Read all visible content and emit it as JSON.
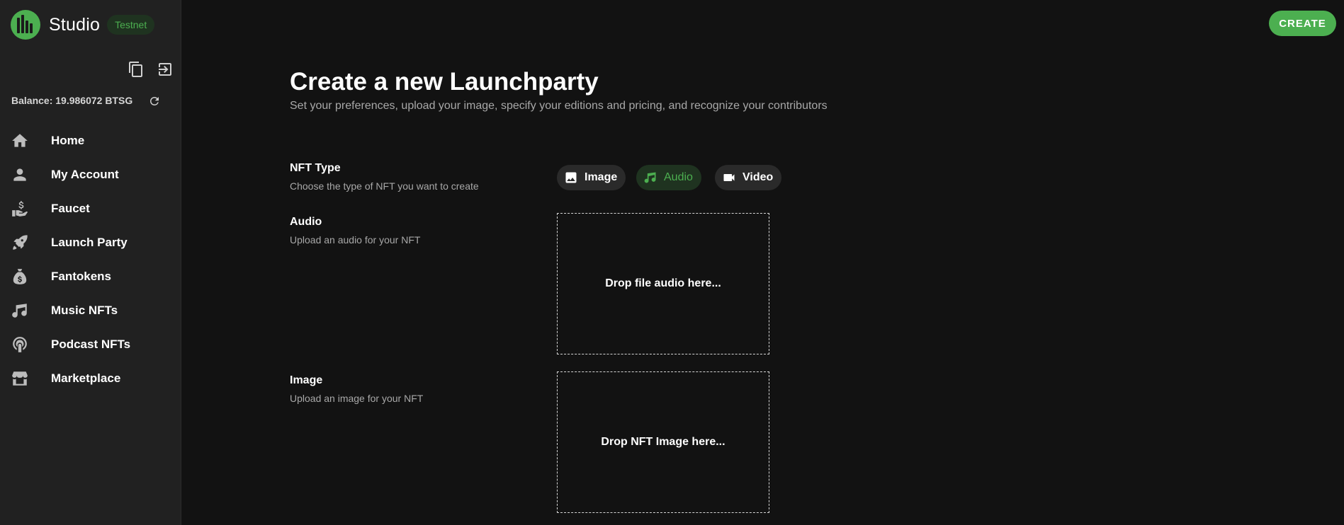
{
  "sidebar": {
    "brand_name": "Studio",
    "network_badge": "Testnet",
    "balance": "Balance: 19.986072 BTSG",
    "nav": [
      {
        "label": "Home",
        "icon": "home-icon"
      },
      {
        "label": "My Account",
        "icon": "person-icon"
      },
      {
        "label": "Faucet",
        "icon": "faucet-hand-dollar-icon"
      },
      {
        "label": "Launch Party",
        "icon": "rocket-icon"
      },
      {
        "label": "Fantokens",
        "icon": "money-bag-icon"
      },
      {
        "label": "Music NFTs",
        "icon": "music-note-icon"
      },
      {
        "label": "Podcast NFTs",
        "icon": "podcast-icon"
      },
      {
        "label": "Marketplace",
        "icon": "storefront-icon"
      }
    ]
  },
  "header": {
    "create_label": "CREATE"
  },
  "main": {
    "title": "Create a new Launchparty",
    "subtitle": "Set your preferences, upload your image, specify your editions and pricing, and recognize your contributors",
    "nft_type": {
      "label": "NFT Type",
      "hint": "Choose the type of NFT you want to create",
      "options": [
        {
          "label": "Image",
          "icon": "image-icon",
          "selected": false
        },
        {
          "label": "Audio",
          "icon": "music-note-icon",
          "selected": true
        },
        {
          "label": "Video",
          "icon": "videocam-icon",
          "selected": false
        }
      ]
    },
    "audio": {
      "label": "Audio",
      "hint": "Upload an audio for your NFT",
      "drop_text": "Drop file audio here..."
    },
    "image": {
      "label": "Image",
      "hint": "Upload an image for your NFT",
      "drop_text": "Drop NFT Image here..."
    }
  },
  "colors": {
    "accent": "#4caf50",
    "background": "#121212",
    "sidebar": "#212121"
  }
}
